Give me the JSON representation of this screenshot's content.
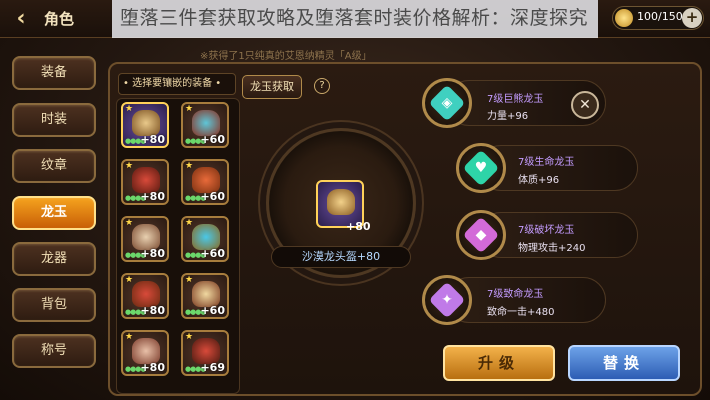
{
  "header": {
    "back_icon": "back-arrow-icon",
    "title": "角色",
    "banner": "堕落三件套获取攻略及堕落套时装价格解析：深度探究",
    "stamina_value": "100/150",
    "stamina_plus": "+"
  },
  "notice": "※获得了1只纯真的艾恩纳精灵「A级」",
  "sidebar": {
    "items": [
      {
        "label": "装备"
      },
      {
        "label": "时装"
      },
      {
        "label": "纹章"
      },
      {
        "label": "龙玉"
      },
      {
        "label": "龙器"
      },
      {
        "label": "背包"
      },
      {
        "label": "称号"
      }
    ],
    "active_index": 3
  },
  "equipment_list": {
    "label": "• 选择要镶嵌的装备 •",
    "items": [
      {
        "value": "+80",
        "icon": "helmet-icon",
        "selected": true
      },
      {
        "value": "+60",
        "icon": "necklace-icon"
      },
      {
        "value": "+80",
        "icon": "armor-icon"
      },
      {
        "value": "+60",
        "icon": "earring-icon"
      },
      {
        "value": "+80",
        "icon": "pants-icon"
      },
      {
        "value": "+60",
        "icon": "ring-icon"
      },
      {
        "value": "+80",
        "icon": "gloves-icon"
      },
      {
        "value": "+60",
        "icon": "bracelet-icon"
      },
      {
        "value": "+80",
        "icon": "boots-icon"
      },
      {
        "value": "+69",
        "icon": "weapon-icon"
      }
    ]
  },
  "obtain_button": "龙玉获取",
  "help_label": "?",
  "center": {
    "item_value": "+80",
    "item_name": "沙漠龙头盔+80"
  },
  "jades": [
    {
      "name": "7级巨熊龙玉",
      "stat": "力量+96",
      "color": "#3fd0c0"
    },
    {
      "name": "7级生命龙玉",
      "stat": "体质+96",
      "color": "#2ed4a8"
    },
    {
      "name": "7级破坏龙玉",
      "stat": "物理攻击+240",
      "color": "#d36ad8"
    },
    {
      "name": "7级致命龙玉",
      "stat": "致命一击+480",
      "color": "#c07ae8"
    }
  ],
  "close_label": "✕",
  "buttons": {
    "upgrade": "升级",
    "replace": "替换"
  },
  "colors": {
    "accent_orange": "#f5a21e",
    "gold_border": "#b08a4a",
    "jade_text": "#c49cff"
  }
}
